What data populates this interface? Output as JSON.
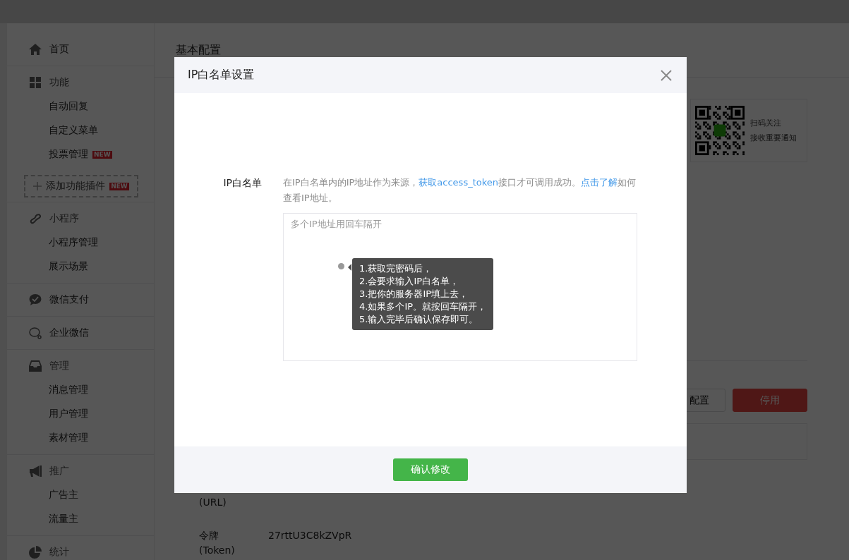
{
  "sidebar": {
    "sections": [
      {
        "title": "首页",
        "kind": "link"
      },
      {
        "title": "功能",
        "kind": "group",
        "items": [
          {
            "label": "自动回复"
          },
          {
            "label": "自定义菜单"
          },
          {
            "label": "投票管理",
            "badge": "NEW"
          }
        ],
        "add_button": {
          "label": "添加功能插件",
          "badge": "NEW"
        }
      },
      {
        "title": "小程序",
        "kind": "group",
        "items": [
          {
            "label": "小程序管理"
          },
          {
            "label": "展示场景"
          }
        ]
      },
      {
        "title": "微信支付",
        "kind": "link"
      },
      {
        "title": "企业微信",
        "kind": "link"
      },
      {
        "title": "管理",
        "kind": "group",
        "items": [
          {
            "label": "消息管理"
          },
          {
            "label": "用户管理"
          },
          {
            "label": "素材管理"
          }
        ]
      },
      {
        "title": "推广",
        "kind": "group",
        "items": [
          {
            "label": "广告主"
          },
          {
            "label": "流量主"
          }
        ]
      },
      {
        "title": "统计",
        "kind": "group"
      }
    ]
  },
  "page": {
    "title": "基本配置",
    "qr_card": {
      "lines": [
        "扫码关注",
        "接收重要通知"
      ]
    },
    "buttons": [
      {
        "label": "配置",
        "kind": "default"
      },
      {
        "label": "停用",
        "kind": "danger"
      }
    ],
    "fields": [
      {
        "label": "(URL)"
      },
      {
        "label": "令牌 (Token)",
        "value": "27rttU3C8kZVpR"
      }
    ]
  },
  "modal": {
    "title": "IP白名单设置",
    "field_label": "IP白名单",
    "description": [
      {
        "kind": "text",
        "text": "在IP白名单内的IP地址作为来源，"
      },
      {
        "kind": "link",
        "text": "获取access_token"
      },
      {
        "kind": "text",
        "text": "接口才可调用成功。"
      },
      {
        "kind": "link",
        "text": "点击了解"
      },
      {
        "kind": "text",
        "text": "如何查看IP地址。"
      }
    ],
    "textarea": {
      "placeholder": "多个IP地址用回车隔开"
    },
    "tooltip": {
      "lines": [
        "1.获取完密码后，",
        "2.会要求输入IP白名单，",
        "3.把你的服务器IP填上去，",
        "4.如果多个IP。就按回车隔开，",
        "5.输入完毕后确认保存即可。"
      ]
    },
    "confirm_button": "确认修改"
  }
}
